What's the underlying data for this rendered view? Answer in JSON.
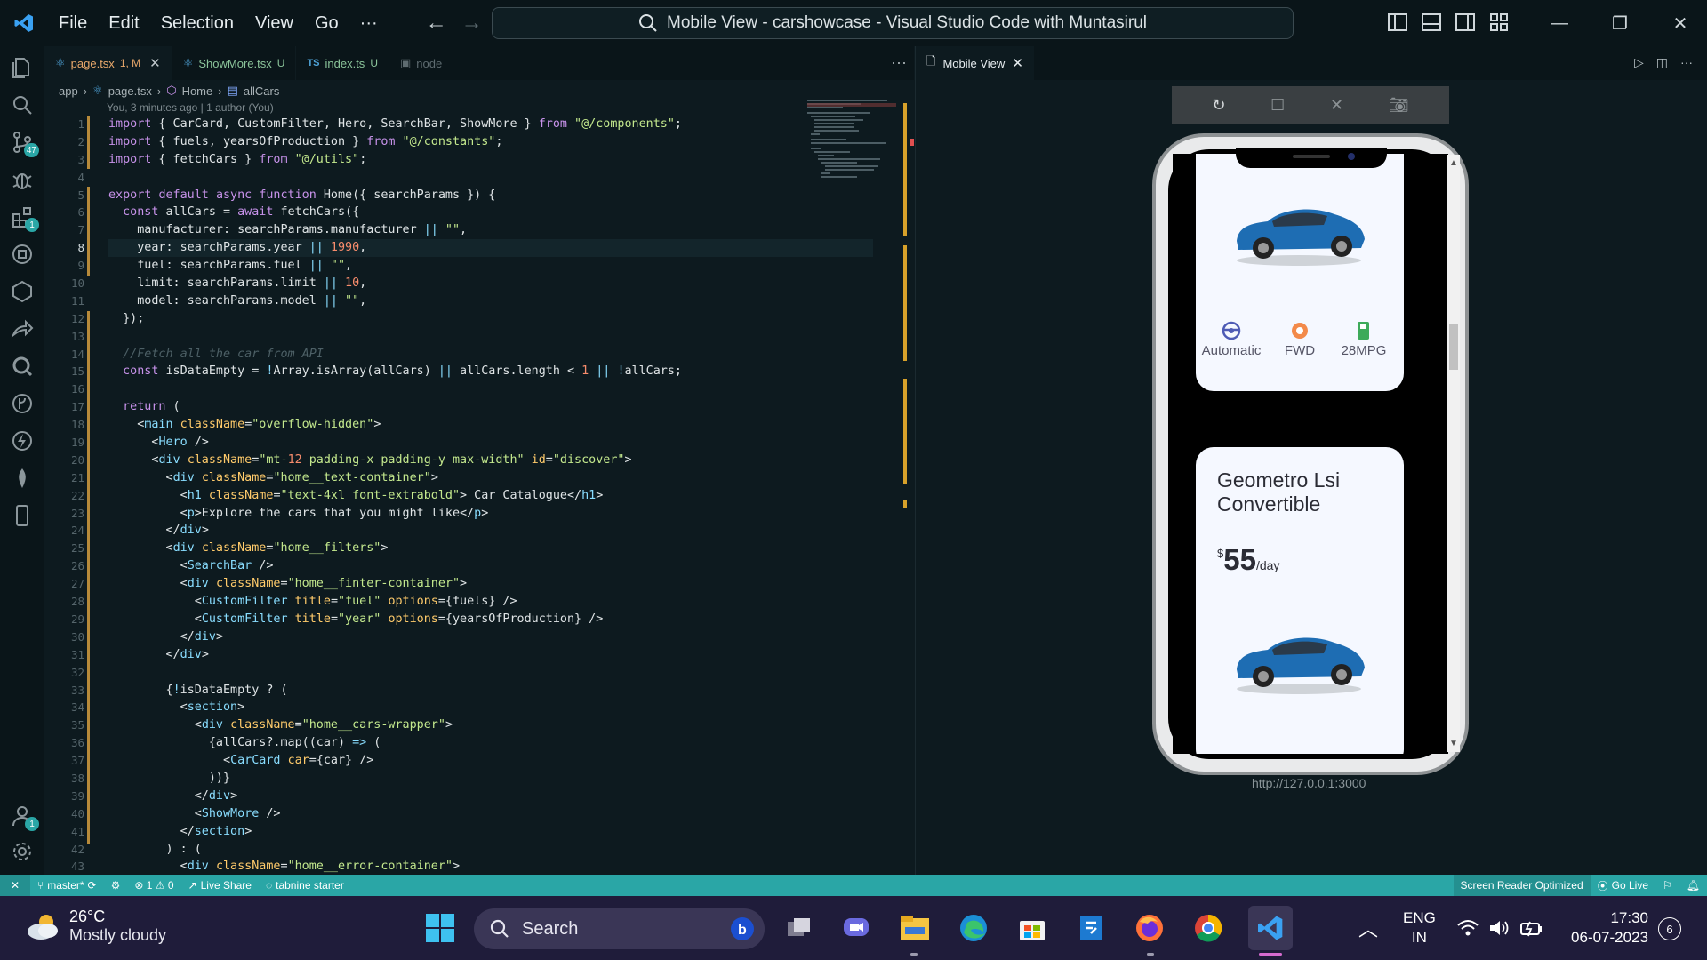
{
  "titlebar": {
    "menu": [
      "File",
      "Edit",
      "Selection",
      "View",
      "Go",
      "···"
    ],
    "command_center": "Mobile View - carshowcase - Visual Studio Code with Muntasirul"
  },
  "activity_badges": {
    "source_control": "47",
    "extensions": "1",
    "accounts": "1"
  },
  "tabs": [
    {
      "label": "page.tsx",
      "mark": "1, M",
      "active": true
    },
    {
      "label": "ShowMore.tsx",
      "mark": "U"
    },
    {
      "label": "index.ts",
      "mark": "U",
      "prefix": "TS"
    },
    {
      "label": "node",
      "mark": ""
    }
  ],
  "breadcrumb": [
    "app",
    "page.tsx",
    "Home",
    "allCars"
  ],
  "editor": {
    "blame": "You, 3 minutes ago | 1 author (You)",
    "current_line": 8,
    "lines": [
      "import { CarCard, CustomFilter, Hero, SearchBar, ShowMore } from \"@/components\";",
      "import { fuels, yearsOfProduction } from \"@/constants\";",
      "import { fetchCars } from \"@/utils\";",
      "",
      "export default async function Home({ searchParams }) {",
      "  const allCars = await fetchCars({",
      "    manufacturer: searchParams.manufacturer || \"\",",
      "    year: searchParams.year || 1990,",
      "    fuel: searchParams.fuel || \"\",",
      "    limit: searchParams.limit || 10,",
      "    model: searchParams.model || \"\",",
      "  });",
      "",
      "  //Fetch all the car from API",
      "  const isDataEmpty = !Array.isArray(allCars) || allCars.length < 1 || !allCars;",
      "",
      "  return (",
      "    <main className=\"overflow-hidden\">",
      "      <Hero />",
      "      <div className=\"mt-12 padding-x padding-y max-width\" id=\"discover\">",
      "        <div className=\"home__text-container\">",
      "          <h1 className=\"text-4xl font-extrabold\"> Car Catalogue</h1>",
      "          <p>Explore the cars that you might like</p>",
      "        </div>",
      "        <div className=\"home__filters\">",
      "          <SearchBar />",
      "          <div className=\"home__finter-container\">",
      "            <CustomFilter title=\"fuel\" options={fuels} />",
      "            <CustomFilter title=\"year\" options={yearsOfProduction} />",
      "          </div>",
      "        </div>",
      "",
      "        {!isDataEmpty ? (",
      "          <section>",
      "            <div className=\"home__cars-wrapper\">",
      "              {allCars?.map((car) => (",
      "                <CarCard car={car} />",
      "              ))}",
      "            </div>",
      "            <ShowMore />",
      "          </section>",
      "        ) : (",
      "          <div className=\"home__error-container\">"
    ]
  },
  "right_panel": {
    "tab_label": "Mobile View",
    "url": "http://127.0.0.1:3000",
    "card1": {
      "specs": [
        {
          "icon": "steering-wheel-icon",
          "label": "Automatic"
        },
        {
          "icon": "tire-icon",
          "label": "FWD"
        },
        {
          "icon": "gas-icon",
          "label": "28MPG"
        }
      ]
    },
    "card2": {
      "title": "Geometro Lsi Convertible",
      "currency": "$",
      "price": "55",
      "per": "/day"
    }
  },
  "statusbar": {
    "branch": "master*",
    "problems": "⊗ 1 ⚠ 0",
    "live_share": "Live Share",
    "tabnine": "tabnine starter",
    "screen_reader": "Screen Reader Optimized",
    "go_live": "Go Live"
  },
  "taskbar": {
    "temperature": "26°C",
    "weather": "Mostly cloudy",
    "search": "Search",
    "lang1": "ENG",
    "lang2": "IN",
    "time": "17:30",
    "date": "06-07-2023",
    "notifications": "6"
  }
}
